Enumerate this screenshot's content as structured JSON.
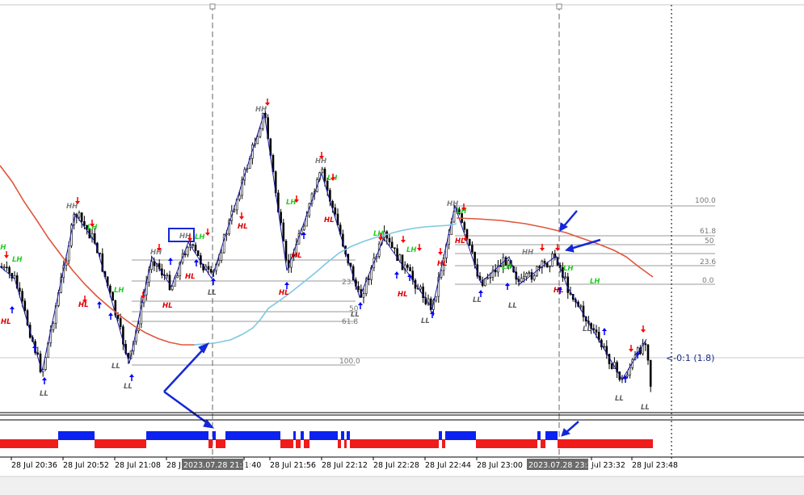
{
  "colors": {
    "background": "#ffffff",
    "candle": "#000000",
    "orange_ma": "#e0563a",
    "blue_ma": "#7ec8e0",
    "hh_label": "#808080",
    "lh_label": "#22cc22",
    "hl_label": "#dd0000",
    "ll_label": "#606060",
    "up_arrow": "#0000ff",
    "down_arrow": "#ff0000",
    "annotation": "#1428d8",
    "fib_line": "#9a9a9a",
    "fib_text": "#777777",
    "bar_blue": "#0b22f0",
    "bar_red": "#f01b1b",
    "grid": "#c0c0c0"
  },
  "fibonacci": {
    "left": [
      {
        "text": "23.6"
      },
      {
        "text": "50"
      },
      {
        "text": "61.8"
      },
      {
        "text": "100.0"
      }
    ],
    "right": [
      {
        "text": "100.0"
      },
      {
        "text": "61.8"
      },
      {
        "text": "50"
      },
      {
        "text": "23.6"
      },
      {
        "text": "0.0"
      }
    ]
  },
  "price_marker": "<-0:1 (1.8)",
  "swing_labels": [
    {
      "text": "HH"
    },
    {
      "text": "HH"
    },
    {
      "text": "HH"
    },
    {
      "text": "HH"
    },
    {
      "text": "HH"
    },
    {
      "text": "HH"
    },
    {
      "text": "HH"
    },
    {
      "text": "LH"
    },
    {
      "text": "LH"
    },
    {
      "text": "LH"
    },
    {
      "text": "LH"
    },
    {
      "text": "LH"
    },
    {
      "text": "LH"
    },
    {
      "text": "LH"
    },
    {
      "text": "LH"
    },
    {
      "text": "LH"
    },
    {
      "text": "LH"
    },
    {
      "text": "LH"
    },
    {
      "text": "LH"
    },
    {
      "text": "LH"
    },
    {
      "text": "HL"
    },
    {
      "text": "HL"
    },
    {
      "text": "HL"
    },
    {
      "text": "HL"
    },
    {
      "text": "HL"
    },
    {
      "text": "HL"
    },
    {
      "text": "HL"
    },
    {
      "text": "HL"
    },
    {
      "text": "HL"
    },
    {
      "text": "HL"
    },
    {
      "text": "LL"
    },
    {
      "text": "LL"
    },
    {
      "text": "LL"
    },
    {
      "text": "LL"
    },
    {
      "text": "LL"
    },
    {
      "text": "LL"
    },
    {
      "text": "LL"
    },
    {
      "text": "LL"
    },
    {
      "text": "LL"
    },
    {
      "text": "LL"
    }
  ],
  "time_axis": {
    "labels": [
      "28 Jul 20:36",
      "28 Jul 20:52",
      "28 Jul 21:08",
      "28 J",
      "1:40",
      "28 Jul 21:56",
      "28 Jul 22:12",
      "28 Jul 22:28",
      "28 Jul 22:44",
      "28 Jul 23:00",
      "Jul 23:32",
      "28 Jul 23:48"
    ],
    "crosshair_1": "2023.07.28 21:38",
    "crosshair_2": "2023.07.28 23:25"
  },
  "indicator_bar": [
    [
      "red",
      72
    ],
    [
      "blue",
      45
    ],
    [
      "red",
      64
    ],
    [
      "blue",
      77
    ],
    [
      "red",
      5
    ],
    [
      "blue",
      4
    ],
    [
      "red",
      12
    ],
    [
      "blue",
      68
    ],
    [
      "red",
      16
    ],
    [
      "blue",
      3
    ],
    [
      "red",
      6
    ],
    [
      "blue",
      4
    ],
    [
      "red",
      7
    ],
    [
      "blue",
      35
    ],
    [
      "red",
      4
    ],
    [
      "blue",
      4
    ],
    [
      "red",
      3
    ],
    [
      "blue",
      4
    ],
    [
      "red",
      110
    ],
    [
      "blue",
      4
    ],
    [
      "red",
      4
    ],
    [
      "blue",
      38
    ],
    [
      "red",
      76
    ],
    [
      "blue",
      4
    ],
    [
      "red",
      6
    ],
    [
      "blue",
      15
    ],
    [
      "red",
      118
    ]
  ]
}
